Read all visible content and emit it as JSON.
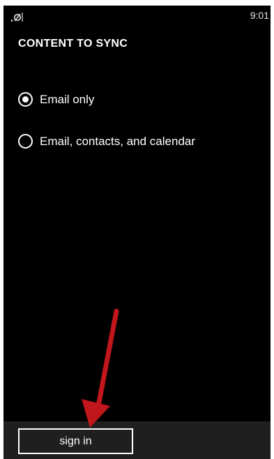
{
  "status_bar": {
    "time": "9:01",
    "signal_icon": "no-signal-icon"
  },
  "title": "CONTENT TO SYNC",
  "options": [
    {
      "label": "Email only",
      "selected": true
    },
    {
      "label": "Email, contacts, and calendar",
      "selected": false
    }
  ],
  "app_bar": {
    "sign_in_label": "sign in"
  },
  "annotation": {
    "arrow_color": "#c0161c"
  },
  "colors": {
    "background": "#000000",
    "foreground": "#ffffff",
    "app_bar": "#1f1f1f"
  }
}
